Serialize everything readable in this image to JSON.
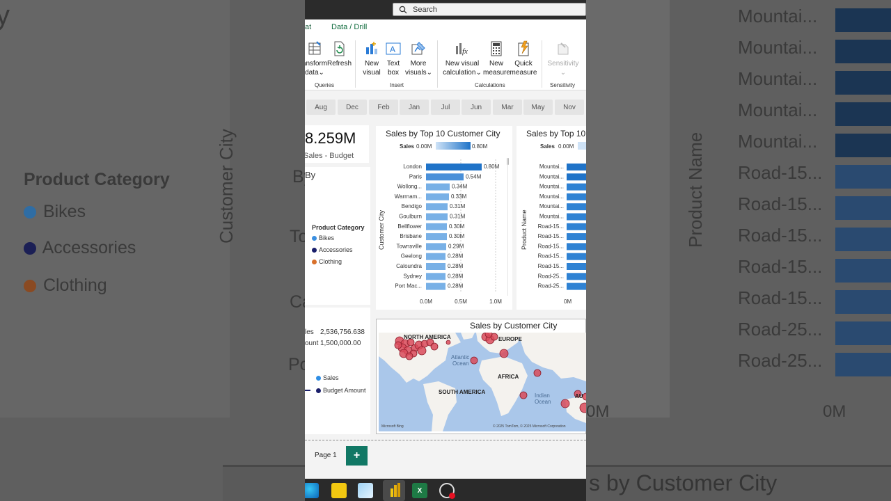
{
  "search": {
    "placeholder": "Search"
  },
  "ribbon_tabs": [
    "at",
    "Data / Drill"
  ],
  "ribbon": {
    "buttons": [
      {
        "label1": "ansform",
        "label2": "data"
      },
      {
        "label1": "Refresh",
        "label2": ""
      },
      {
        "label1": "New",
        "label2": "visual"
      },
      {
        "label1": "Text",
        "label2": "box"
      },
      {
        "label1": "More",
        "label2": "visuals"
      },
      {
        "label1": "New visual",
        "label2": "calculation"
      },
      {
        "label1": "New",
        "label2": "measure"
      },
      {
        "label1": "Quick",
        "label2": "measure"
      },
      {
        "label1": "Sensitivity",
        "label2": ""
      }
    ],
    "groups": [
      "Queries",
      "Insert",
      "Calculations",
      "Sensitivity"
    ]
  },
  "months": [
    "Aug",
    "Dec",
    "Feb",
    "Jan",
    "Jul",
    "Jun",
    "Mar",
    "May",
    "Nov"
  ],
  "kpi": {
    "value": "8.259M",
    "label": "Sales - Budget"
  },
  "left_panel": {
    "by": "By",
    "legend_title": "Product Category",
    "legend": [
      {
        "name": "Bikes",
        "color": "#3b8fe0"
      },
      {
        "name": "Accessories",
        "color": "#1a1f6b"
      },
      {
        "name": "Clothing",
        "color": "#d9702a"
      }
    ],
    "to": "To",
    "rows": [
      {
        "label": "les",
        "value": "2,536,756.638"
      },
      {
        "label": "ount",
        "value": "1,500,000.00"
      }
    ],
    "legend2": [
      {
        "name": "Sales",
        "color": "#2f8ee5"
      },
      {
        "name": "Budget Amount",
        "color": "#1a1f6b"
      }
    ]
  },
  "chart_data": [
    {
      "type": "bar",
      "title": "Sales by Top 10 Customer City",
      "legend": {
        "label": "Sales",
        "min": "0.00M",
        "max": "0.80M"
      },
      "ylabel": "Customer City",
      "categories": [
        "London",
        "Paris",
        "Wollong...",
        "Warrnam...",
        "Bendigo",
        "Goulburn",
        "Bellflower",
        "Brisbane",
        "Townsville",
        "Geelong",
        "Caloundra",
        "Sydney",
        "Port Mac..."
      ],
      "values": [
        0.8,
        0.54,
        0.34,
        0.33,
        0.31,
        0.31,
        0.3,
        0.3,
        0.29,
        0.28,
        0.28,
        0.28,
        0.28
      ],
      "data_labels": [
        "0.80M",
        "0.54M",
        "0.34M",
        "0.33M",
        "0.31M",
        "0.31M",
        "0.30M",
        "0.30M",
        "0.29M",
        "0.28M",
        "0.28M",
        "0.28M",
        "0.28M"
      ],
      "xticks": [
        "0.0M",
        "0.5M",
        "1.0M"
      ],
      "xlim": [
        0,
        1.0
      ]
    },
    {
      "type": "bar",
      "title": "Sales by Top 10",
      "legend": {
        "label": "Sales",
        "min": "0.00M"
      },
      "ylabel": "Product Name",
      "categories": [
        "Mountai...",
        "Mountai...",
        "Mountai...",
        "Mountai...",
        "Mountai...",
        "Mountai...",
        "Road-15...",
        "Road-15...",
        "Road-15...",
        "Road-15...",
        "Road-15...",
        "Road-25...",
        "Road-25..."
      ],
      "xticks": [
        "0M"
      ]
    }
  ],
  "map": {
    "title": "Sales by Customer City",
    "labels": [
      "NORTH AMERICA",
      "EUROPE",
      "Atlantic Ocean",
      "AFRICA",
      "SOUTH AMERICA",
      "Indian Ocean",
      "AU"
    ],
    "credit_left": "Microsoft Bing",
    "credit_right": "© 2025 TomTom, © 2025 Microsoft Corporation"
  },
  "pages": {
    "page1": "Page 1",
    "add": "+"
  },
  "background": {
    "left_texts": [
      "y",
      "Customer City",
      "Product Category",
      "Bikes",
      "Accessories",
      "Clothing",
      "By",
      "To",
      "Ca",
      "Po",
      "les  2,536,756.638"
    ],
    "right_texts": [
      "Product Name",
      "Mountai...",
      "Road-15...",
      "Road-25...",
      "0M"
    ],
    "bottom_text": "s by Customer City"
  }
}
